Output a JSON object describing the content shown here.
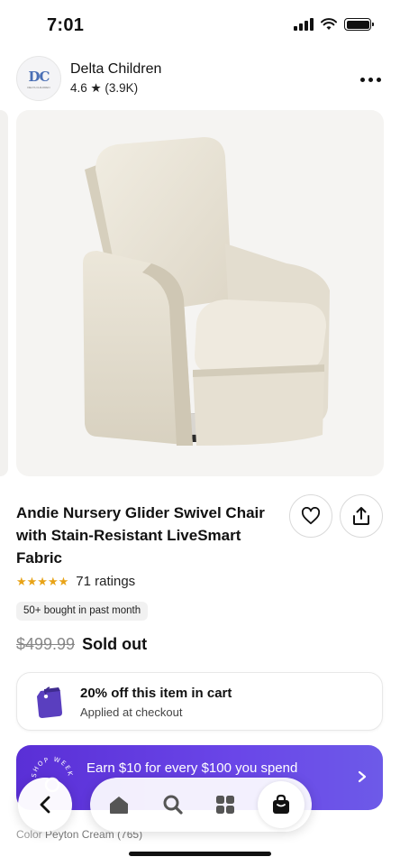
{
  "status_bar": {
    "time": "7:01"
  },
  "seller": {
    "logo_text": "DC",
    "logo_subtext": "DELTA CHILDREN",
    "name": "Delta Children",
    "rating": "4.6 ★ (3.9K)"
  },
  "product": {
    "image_alt": "Cream glider swivel chair",
    "title": "Andie Nursery Glider Swivel Chair with Stain-Resistant LiveSmart Fabric",
    "stars": "★★★★★",
    "ratings_count": "71 ratings",
    "bought_badge": "50+ bought in past month",
    "old_price": "$499.99",
    "status": "Sold out"
  },
  "promo": {
    "title": "20% off this item in cart",
    "subtitle": "Applied at checkout"
  },
  "earn_banner": {
    "text": "Earn $10 for every $100 you spend",
    "seal_text": "SHOP WEEK"
  },
  "color_row": {
    "label": "Color",
    "value": "Peyton Cream (765)"
  },
  "nav": {
    "items": [
      "home",
      "search",
      "categories",
      "cart"
    ]
  },
  "colors": {
    "accent_purple": "#5a2fd6",
    "star_gold": "#e8a317",
    "chair_fabric": "#ece7da"
  }
}
